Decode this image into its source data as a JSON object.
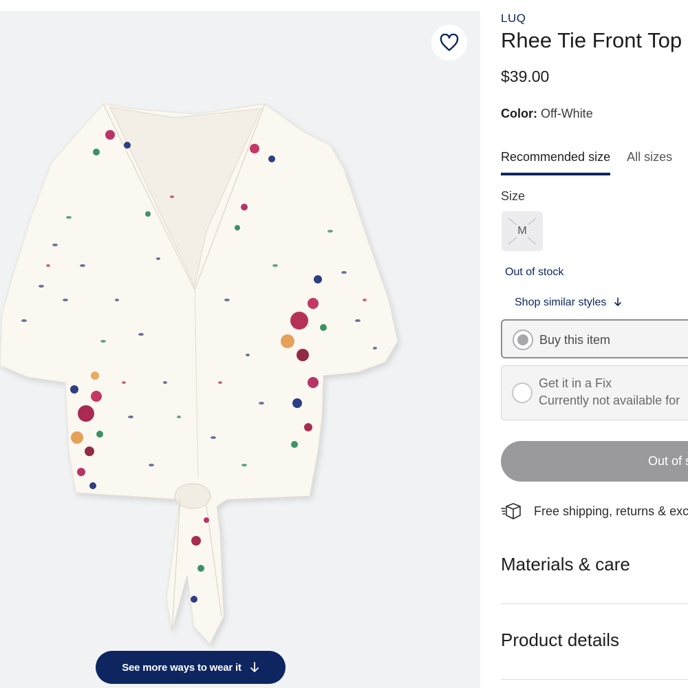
{
  "image": {
    "favorite_icon": "heart-outline-icon",
    "more_ways_label": "See more ways to wear it",
    "more_ways_icon": "arrow-down-icon"
  },
  "product": {
    "brand": "LUQ",
    "title": "Rhee Tie Front Top",
    "price": "$39.00",
    "color_label": "Color:",
    "color_value": "Off-White"
  },
  "size_tabs": [
    {
      "label": "Recommended size",
      "active": true
    },
    {
      "label": "All sizes",
      "active": false
    }
  ],
  "size": {
    "label": "Size",
    "selected": "M",
    "availability": "Out of stock",
    "shop_similar": "Shop similar styles"
  },
  "purchase_options": {
    "buy": {
      "title": "Buy this item",
      "selected": true
    },
    "fix": {
      "title": "Get it in a Fix",
      "subtitle": "Currently not available for"
    }
  },
  "cta": {
    "label": "Out of stock"
  },
  "shipping": {
    "icon": "box-icon",
    "text": "Free shipping, returns & exchanges"
  },
  "sections": {
    "materials": "Materials & care",
    "details": "Product details"
  },
  "colors": {
    "navy": "#0d2660",
    "disabled_button": "#9a9a9c",
    "image_background": "#f1f2f4"
  }
}
